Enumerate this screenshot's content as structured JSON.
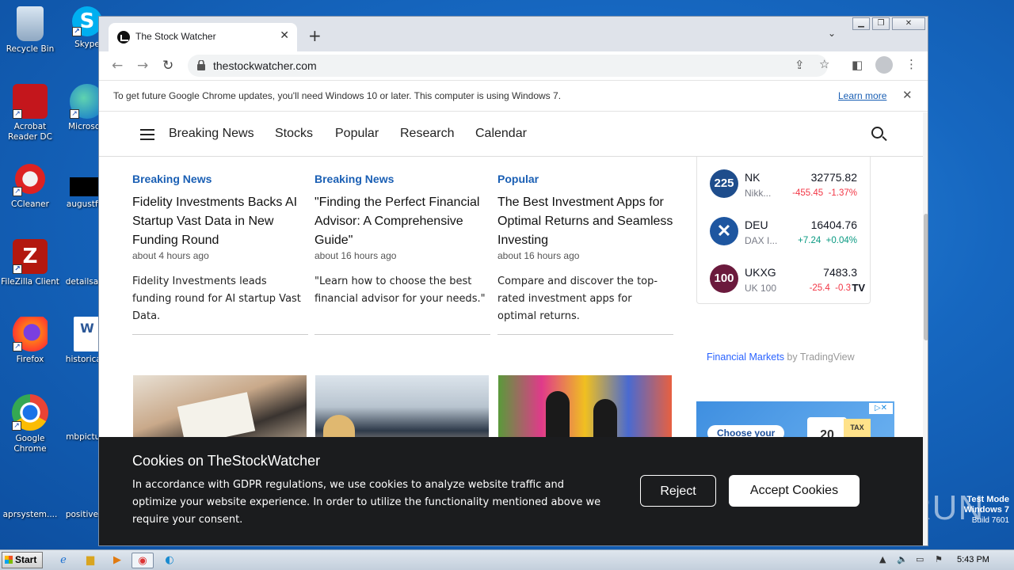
{
  "desktop": {
    "icons": [
      {
        "label": "Recycle Bin"
      },
      {
        "label": "Skype"
      },
      {
        "label": "Acrobat Reader DC"
      },
      {
        "label": "Microsoft"
      },
      {
        "label": "CCleaner"
      },
      {
        "label": "augustfiln"
      },
      {
        "label": "FileZilla Client"
      },
      {
        "label": "detailsago"
      },
      {
        "label": "Firefox"
      },
      {
        "label": "historicale"
      },
      {
        "label": "Google Chrome"
      },
      {
        "label": "mbpicture"
      },
      {
        "label": "aprsystem...."
      },
      {
        "label": "positivede"
      }
    ],
    "watermark": {
      "line1": "Test Mode",
      "line2": "Windows 7",
      "line3": "Build 7601"
    },
    "anyrun": "ANY RUN"
  },
  "browser": {
    "tab_title": "The Stock Watcher",
    "url": "thestockwatcher.com",
    "info_message": "To get future Google Chrome updates, you'll need Windows 10 or later. This computer is using Windows 7.",
    "info_link": "Learn more"
  },
  "site": {
    "nav": [
      "Breaking News",
      "Stocks",
      "Popular",
      "Research",
      "Calendar"
    ],
    "articles": [
      {
        "category": "Breaking News",
        "headline": "Fidelity Investments Backs AI Startup Vast Data in New Funding Round",
        "time": "about 4 hours ago",
        "summary": "Fidelity Investments leads funding round for AI startup Vast Data."
      },
      {
        "category": "Breaking News",
        "headline": "\"Finding the Perfect Financial Advisor: A Comprehensive Guide\"",
        "time": "about 16 hours ago",
        "summary": "\"Learn how to choose the best financial advisor for your needs.\""
      },
      {
        "category": "Popular",
        "headline": "The Best Investment Apps for Optimal Returns and Seamless Investing",
        "time": "about 16 hours ago",
        "summary": "Compare and discover the top-rated investment apps for optimal returns."
      }
    ],
    "ticker": [
      {
        "logo": "225",
        "symbol": "NK",
        "name": "Nikk...",
        "price": "32775.82",
        "change": "-455.45",
        "pct": "-1.37%",
        "dir": "neg",
        "color": "#1e4d8c"
      },
      {
        "logo": "",
        "symbol": "DEU",
        "name": "DAX I...",
        "price": "16404.76",
        "change": "+7.24",
        "pct": "+0.04%",
        "dir": "pos",
        "color": "#1e56a0"
      },
      {
        "logo": "100",
        "symbol": "UKXG",
        "name": "UK 100",
        "price": "7483.3",
        "change": "-25.4",
        "pct": "-0.3",
        "dir": "neg",
        "color": "#6b1a3d"
      }
    ],
    "tradingview": {
      "link": "Financial Markets",
      "by": " by TradingView"
    },
    "ad": {
      "pill": "Choose your",
      "tax": "TAX",
      "day": "20"
    },
    "cookie": {
      "title": "Cookies on TheStockWatcher",
      "body": "In accordance with GDPR regulations, we use cookies to analyze website traffic and optimize your website experience. In order to utilize the functionality mentioned above we require your consent.",
      "reject": "Reject",
      "accept": "Accept Cookies"
    }
  },
  "taskbar": {
    "start": "Start",
    "clock": "5:43 PM"
  }
}
